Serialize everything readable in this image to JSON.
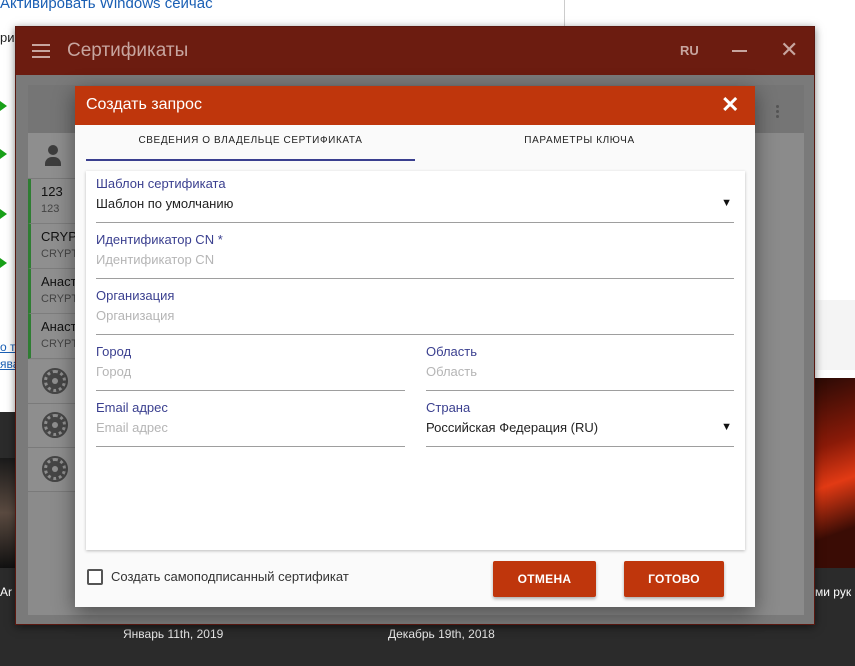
{
  "background": {
    "activate_link": "Активировать Windows сейчас",
    "partial_text": "ри",
    "link_1": "о т",
    "link_2": "ява",
    "caption_left": "Ar",
    "caption_right": "ми рук",
    "dates": [
      "Январь 11th, 2019",
      "Декабрь 19th, 2018"
    ]
  },
  "app": {
    "title": "Сертификаты",
    "language": "RU",
    "certificates": [
      {
        "line1": "123",
        "line2": "123"
      },
      {
        "line1": "CRYP",
        "line2": "CRYPT"
      },
      {
        "line1": "Анаст",
        "line2": "CRYPT"
      },
      {
        "line1": "Анаст",
        "line2": "CRYPT"
      }
    ]
  },
  "dialog": {
    "title": "Создать запрос",
    "tabs": [
      {
        "label": "СВЕДЕНИЯ О ВЛАДЕЛЬЦЕ СЕРТИФИКАТА",
        "active": true
      },
      {
        "label": "ПАРАМЕТРЫ КЛЮЧА",
        "active": false
      }
    ],
    "fields": {
      "template": {
        "label": "Шаблон сертификата",
        "value": "Шаблон по умолчанию"
      },
      "cn": {
        "label": "Идентификатор CN *",
        "placeholder": "Идентификатор CN"
      },
      "organization": {
        "label": "Организация",
        "placeholder": "Организация"
      },
      "city": {
        "label": "Город",
        "placeholder": "Город"
      },
      "region": {
        "label": "Область",
        "placeholder": "Область"
      },
      "email": {
        "label": "Email адрес",
        "placeholder": "Email адрес"
      },
      "country": {
        "label": "Страна",
        "value": "Российская Федерация (RU)"
      }
    },
    "self_signed_label": "Создать самоподписанный сертификат",
    "cancel_label": "ОТМЕНА",
    "done_label": "ГОТОВО"
  },
  "colors": {
    "accent": "#bf360c",
    "app_header": "#6c1c10",
    "label": "#3a3f8f"
  }
}
